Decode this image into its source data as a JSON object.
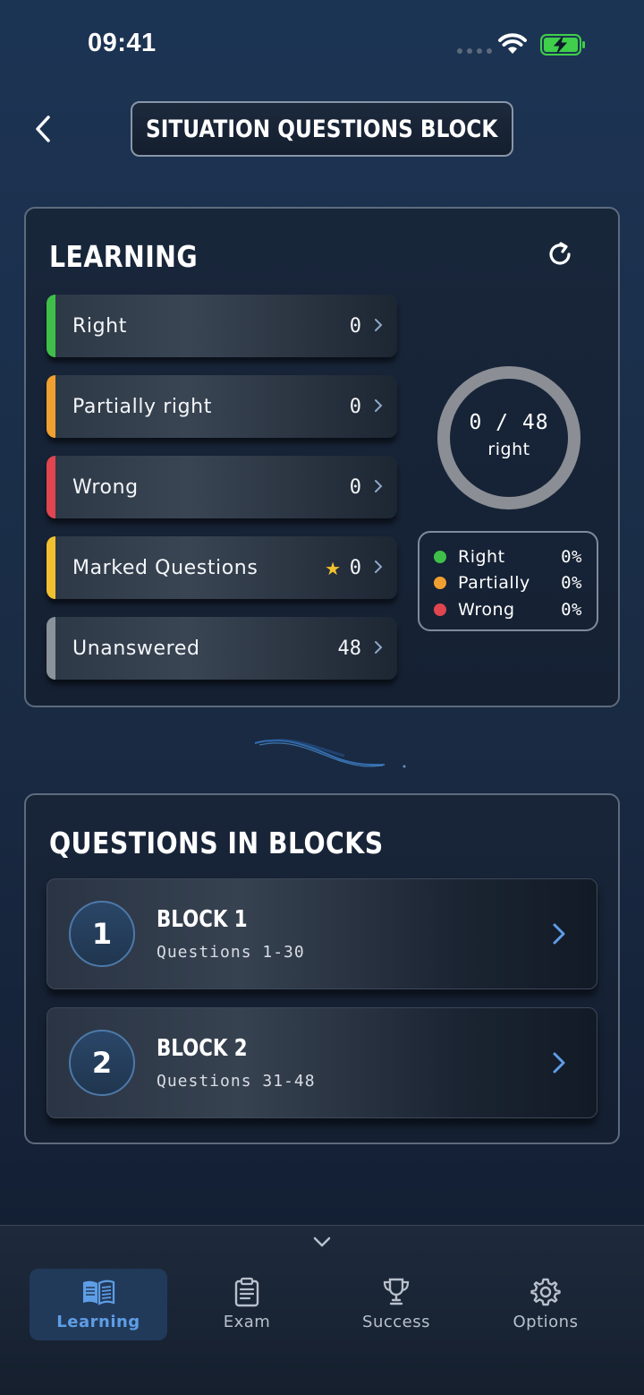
{
  "status_bar": {
    "time": "09:41"
  },
  "header": {
    "title": "SITUATION QUESTIONS BLOCK"
  },
  "learning": {
    "title": "LEARNING",
    "stats": [
      {
        "label": "Right",
        "value": "0",
        "color": "#3fbf4a"
      },
      {
        "label": "Partially right",
        "value": "0",
        "color": "#f0a030"
      },
      {
        "label": "Wrong",
        "value": "0",
        "color": "#e04550"
      },
      {
        "label": "Marked Questions",
        "value": "0",
        "color": "#f0c030",
        "star": "★"
      },
      {
        "label": "Unanswered",
        "value": "48",
        "color": "#8a929c"
      }
    ],
    "progress": {
      "text": "0 / 48",
      "label": "right",
      "answered_right": 0,
      "total": 48
    },
    "legend": [
      {
        "name": "Right",
        "value": "0%",
        "color": "#3fbf4a"
      },
      {
        "name": "Partially",
        "value": "0%",
        "color": "#f0a030"
      },
      {
        "name": "Wrong",
        "value": "0%",
        "color": "#e04550"
      }
    ]
  },
  "blocks": {
    "title": "QUESTIONS IN BLOCKS",
    "items": [
      {
        "number": "1",
        "name": "BLOCK 1",
        "range": "Questions 1-30"
      },
      {
        "number": "2",
        "name": "BLOCK 2",
        "range": "Questions 31-48"
      }
    ]
  },
  "nav": {
    "items": [
      {
        "label": "Learning",
        "icon": "book-icon",
        "active": true
      },
      {
        "label": "Exam",
        "icon": "clipboard-icon",
        "active": false
      },
      {
        "label": "Success",
        "icon": "trophy-icon",
        "active": false
      },
      {
        "label": "Options",
        "icon": "gear-icon",
        "active": false
      }
    ]
  },
  "colors": {
    "accent": "#5e9ee6",
    "background": "#1a2c45"
  }
}
